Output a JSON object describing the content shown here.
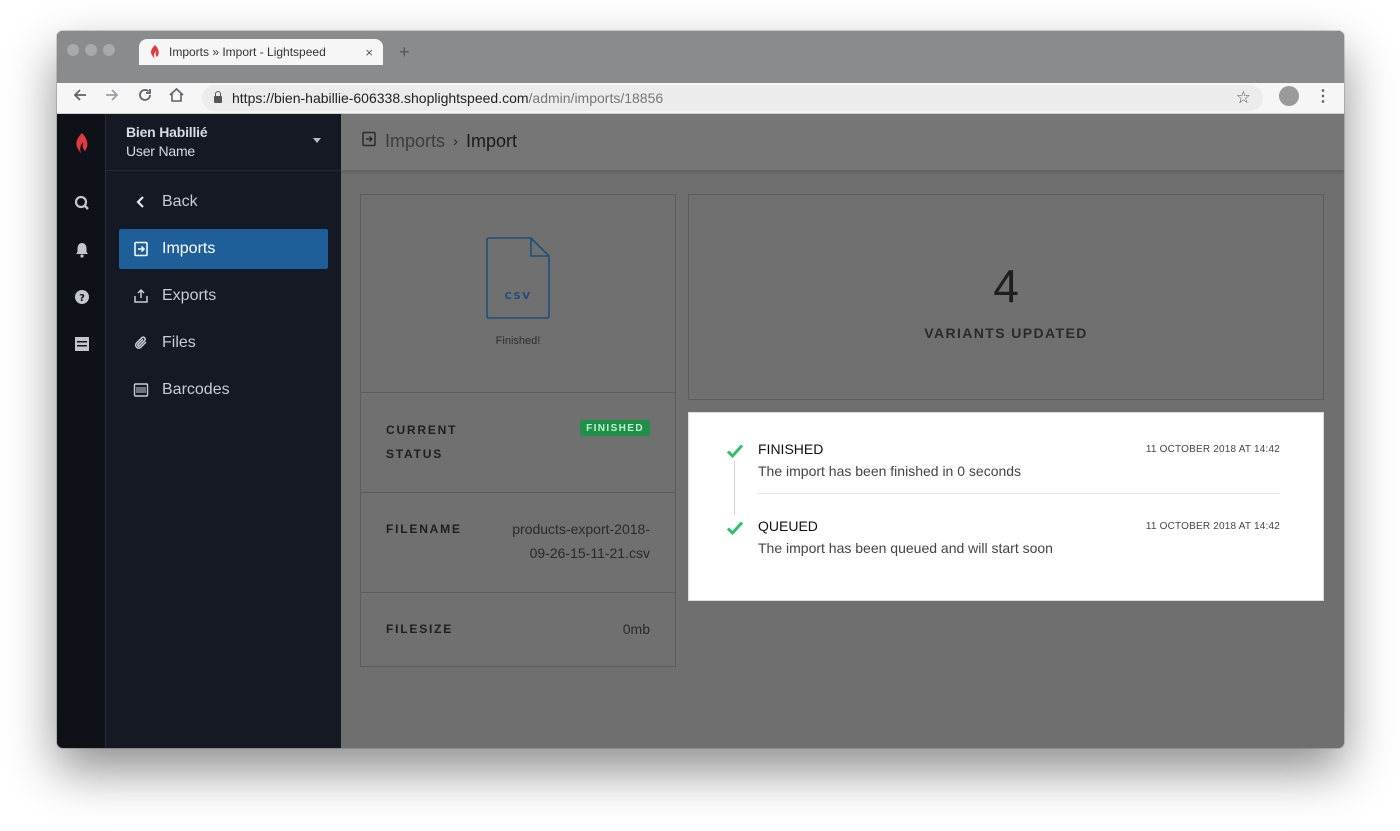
{
  "browser": {
    "tab_title": "Imports » Import - Lightspeed",
    "tab_close": "×",
    "new_tab": "+",
    "url_base": "https://bien-habillie-606338.shoplightspeed.com",
    "url_path": "/admin/imports/18856"
  },
  "store": {
    "name": "Bien Habillié",
    "user": "User Name"
  },
  "sidebar": {
    "items": [
      {
        "label": "Back",
        "icon": "chevron-left-icon"
      },
      {
        "label": "Imports",
        "icon": "import-icon",
        "active": true
      },
      {
        "label": "Exports",
        "icon": "export-icon"
      },
      {
        "label": "Files",
        "icon": "paperclip-icon"
      },
      {
        "label": "Barcodes",
        "icon": "barcode-icon"
      }
    ]
  },
  "breadcrumb": {
    "parent": "Imports",
    "separator": "›",
    "current": "Import"
  },
  "file": {
    "type": "CSV",
    "status": "Finished!",
    "current_status_label_line1": "CURRENT",
    "current_status_label_line2": "STATUS",
    "current_status_badge": "FINISHED",
    "filename_label": "FILENAME",
    "filename_line1": "products-export-2018-",
    "filename_line2": "09-26-15-11-21.csv",
    "filesize_label": "FILESIZE",
    "filesize": "0mb"
  },
  "stats": {
    "count": "4",
    "label": "VARIANTS UPDATED"
  },
  "timeline": [
    {
      "title": "FINISHED",
      "description": "The import has been finished in 0 seconds",
      "time": "11 OCTOBER 2018 AT 14:42"
    },
    {
      "title": "QUEUED",
      "description": "The import has been queued and will start soon",
      "time": "11 OCTOBER 2018 AT 14:42"
    }
  ],
  "colors": {
    "accent": "#1e5f99",
    "success": "#2dbf6a",
    "sidebar_bg": "#141923"
  }
}
